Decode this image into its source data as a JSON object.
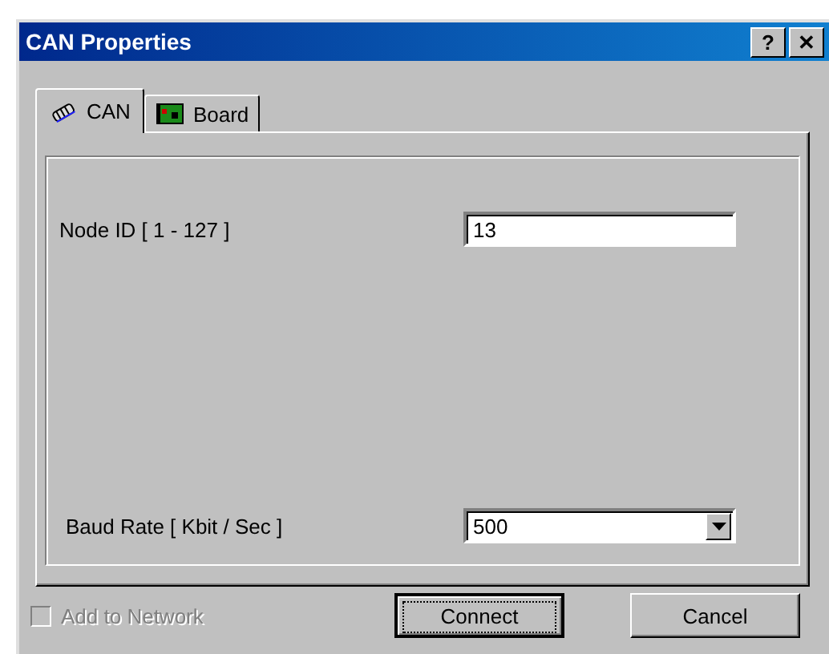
{
  "window": {
    "title": "CAN Properties",
    "help_button": "?",
    "close_button": "✕"
  },
  "tabs": [
    {
      "label": "CAN",
      "selected": true,
      "kind": "can"
    },
    {
      "label": "Board",
      "selected": false,
      "kind": "board"
    }
  ],
  "fields": [
    {
      "label": "Node ID [ 1 - 127 ]",
      "value": "13",
      "kind": "text"
    },
    {
      "label": "Baud Rate [ Kbit / Sec ]",
      "value": "500",
      "kind": "dropdown"
    }
  ],
  "add_to_network": {
    "label": "Add to Network",
    "checked": false,
    "disabled": true
  },
  "buttons": [
    {
      "label": "Connect",
      "kind": "default"
    },
    {
      "label": "Cancel",
      "kind": "normal"
    }
  ]
}
